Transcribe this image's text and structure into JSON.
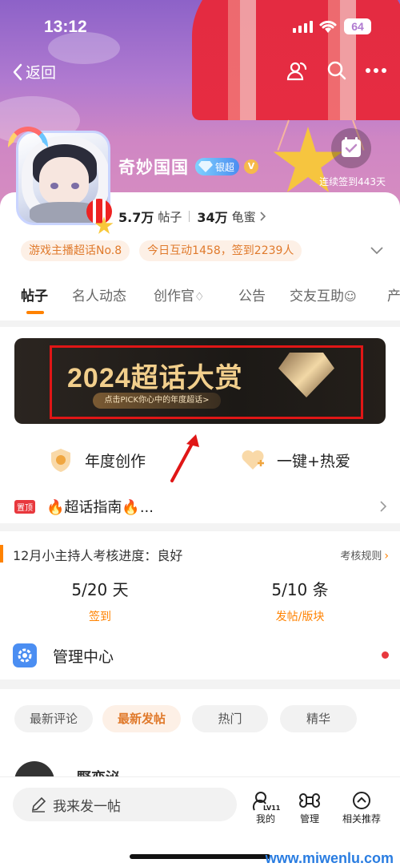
{
  "status_bar": {
    "time": "13:12",
    "battery": "64"
  },
  "nav": {
    "back_label": "返回"
  },
  "profile": {
    "name": "奇妙国国",
    "tier_badge": "银超",
    "checkin_text": "连续签到443天",
    "posts_count": "5.7万",
    "posts_label": "帖子",
    "fans_count": "34万",
    "fans_label": "龟蜜"
  },
  "tags": [
    "游戏主播超话No.8",
    "今日互动1458，签到2239人"
  ],
  "tabs": [
    "帖子",
    "名人动态",
    "创作官",
    "公告",
    "交友互助",
    "产"
  ],
  "banner": {
    "title": "2024超话大赏",
    "subtitle": "点击PICK你心中的年度超话>"
  },
  "quick_actions": {
    "left": "年度创作",
    "right": "一键+热爱"
  },
  "notice": {
    "pin_label": "置顶",
    "text": "🔥超话指南🔥..."
  },
  "assessment": {
    "title": "12月小主持人考核进度：良好",
    "rules_label": "考核规则",
    "metric1_value": "5/20 天",
    "metric1_label": "签到",
    "metric2_value": "5/10 条",
    "metric2_label": "发帖/版块"
  },
  "management": {
    "label": "管理中心"
  },
  "filters": [
    "最新评论",
    "最新发帖",
    "热门",
    "精华"
  ],
  "post_preview": {
    "author": "野恋泌"
  },
  "bottom_bar": {
    "compose_placeholder": "我来发一帖",
    "level_badge": "LV11",
    "nav": [
      "我的",
      "管理",
      "相关推荐"
    ]
  },
  "watermark": "www.miwenlu.com",
  "colors": {
    "accent": "#ff8200",
    "highlight_red": "#e01616",
    "link_blue": "#4b8ef2"
  }
}
